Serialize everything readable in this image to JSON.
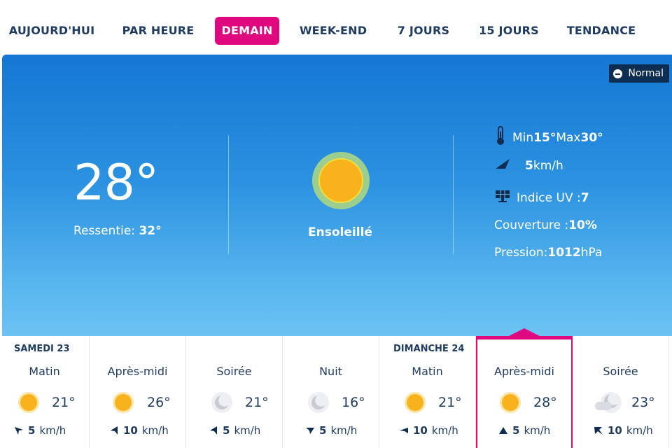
{
  "tabs": [
    {
      "label": "AUJOURD'HUI",
      "active": false
    },
    {
      "label": "PAR HEURE",
      "active": false
    },
    {
      "label": "DEMAIN",
      "active": true
    },
    {
      "label": "WEEK-END",
      "active": false
    },
    {
      "label": "7 JOURS",
      "active": false
    },
    {
      "label": "15 JOURS",
      "active": false
    },
    {
      "label": "TENDANCE",
      "active": false
    }
  ],
  "colors": {
    "accent": "#e0087e",
    "text": "#1f3b5f",
    "hero_top": "#1577d3",
    "hero_bottom": "#6cc3f3"
  },
  "hero": {
    "mode_button": "Normal",
    "temperature": "28°",
    "feels_label": "Ressentie: ",
    "feels_value": "32°",
    "condition": "Ensoleillé",
    "condition_icon": "sun-icon",
    "details": {
      "min_label": "Min ",
      "min_value": "15°",
      "max_label": " Max ",
      "max_value": "30°",
      "wind_value": "5",
      "wind_unit": " km/h",
      "uv_label": "Indice UV : ",
      "uv_value": "7",
      "cover_label": "Couverture : ",
      "cover_value": "10%",
      "pressure_label": "Pression: ",
      "pressure_value": "1012",
      "pressure_unit": " hPa"
    }
  },
  "forecast": [
    {
      "day": "SAMEDI 23",
      "period": "Matin",
      "icon": "sun-icon",
      "temp": "21°",
      "wind": "5",
      "unit": "km/h",
      "wind_dir": "arrow-up-left-icon"
    },
    {
      "day": "",
      "period": "Après-midi",
      "icon": "sun-icon",
      "temp": "26°",
      "wind": "10",
      "unit": "km/h",
      "wind_dir": "arrow-left-icon"
    },
    {
      "day": "",
      "period": "Soirée",
      "icon": "moon-icon",
      "temp": "21°",
      "wind": "5",
      "unit": "km/h",
      "wind_dir": "arrow-left-icon"
    },
    {
      "day": "",
      "period": "Nuit",
      "icon": "moon-icon",
      "temp": "16°",
      "wind": "5",
      "unit": "km/h",
      "wind_dir": "arrow-down-icon"
    },
    {
      "day": "DIMANCHE 24",
      "period": "Matin",
      "icon": "sun-icon",
      "temp": "21°",
      "wind": "10",
      "unit": "km/h",
      "wind_dir": "arrow-left-icon"
    },
    {
      "day": "",
      "period": "Après-midi",
      "icon": "sun-icon",
      "temp": "28°",
      "wind": "5",
      "unit": "km/h",
      "wind_dir": "arrow-up-icon",
      "selected": true
    },
    {
      "day": "",
      "period": "Soirée",
      "icon": "moon-cloud-icon",
      "temp": "23°",
      "wind": "10",
      "unit": "km/h",
      "wind_dir": "arrow-down-right-icon"
    }
  ]
}
